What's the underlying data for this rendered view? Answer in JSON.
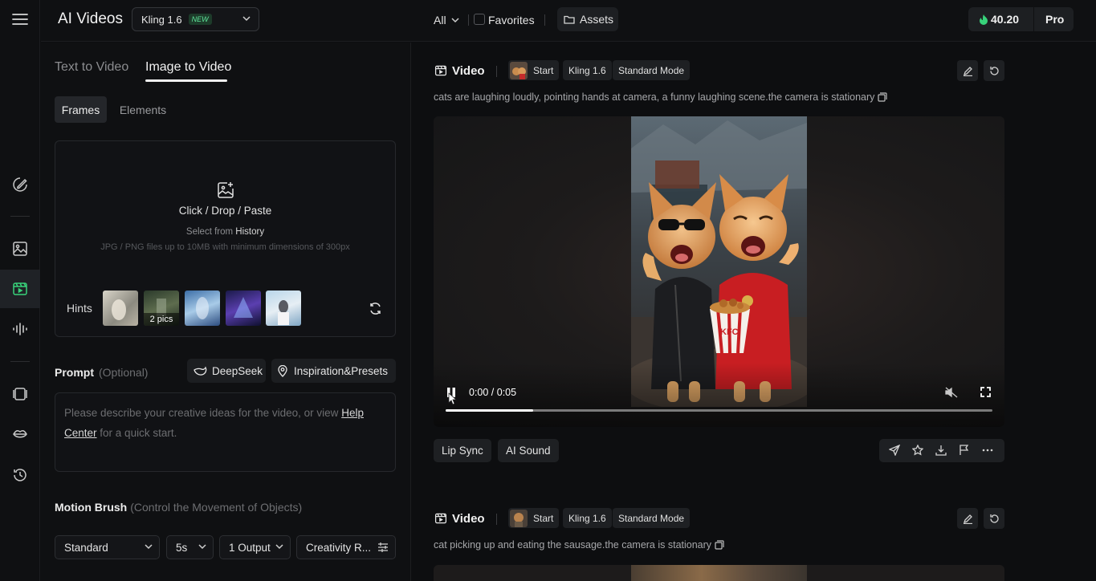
{
  "header": {
    "app_title": "AI Videos",
    "model_name": "Kling 1.6",
    "model_badge": "NEW",
    "filter_all": "All",
    "favorites_label": "Favorites",
    "assets_label": "Assets",
    "credits": "40.20",
    "plan": "Pro"
  },
  "sidebar": {
    "icons": [
      "menu-icon",
      "brush-icon",
      "image-icon",
      "video-icon",
      "audio-wave-icon",
      "film-icon",
      "lips-icon",
      "history-icon"
    ],
    "active": "video-icon"
  },
  "left_panel": {
    "tabs": [
      {
        "label": "Text to Video",
        "active": false
      },
      {
        "label": "Image to Video",
        "active": true
      }
    ],
    "segments": [
      {
        "label": "Frames",
        "active": true
      },
      {
        "label": "Elements",
        "active": false
      }
    ],
    "upload": {
      "main": "Click / Drop / Paste",
      "select_prefix": "Select from",
      "select_link": "History",
      "note": "JPG / PNG files up to 10MB with minimum dimensions of 300px"
    },
    "hints": {
      "label": "Hints",
      "badge": "2 pics"
    },
    "prompt": {
      "label": "Prompt",
      "optional": "(Optional)",
      "deepseek": "DeepSeek",
      "inspiration": "Inspiration&Presets",
      "placeholder_a": "Please describe your creative ideas for the video, or view",
      "help_link_a": "Help",
      "help_link_b": "Center",
      "placeholder_b": "for a quick start."
    },
    "motion_brush": {
      "label": "Motion Brush",
      "sub": "(Control the Movement of Objects)"
    },
    "options": {
      "mode": "Standard",
      "duration": "5s",
      "outputs": "1 Output",
      "creativity": "Creativity R..."
    }
  },
  "cards": [
    {
      "title": "Video",
      "start_label": "Start",
      "model": "Kling 1.6",
      "mode": "Standard Mode",
      "prompt": "cats are laughing loudly, pointing hands at camera, a funny laughing scene.the camera is stationary",
      "time": "0:00 / 0:05",
      "progress": 0.16,
      "lip_sync": "Lip Sync",
      "ai_sound": "AI Sound"
    },
    {
      "title": "Video",
      "start_label": "Start",
      "model": "Kling 1.6",
      "mode": "Standard Mode",
      "prompt": "cat picking up and eating the sausage.the camera is stationary"
    }
  ],
  "colors": {
    "accent": "#38d27a",
    "background": "#0d0e10",
    "panel": "#0f1012"
  }
}
